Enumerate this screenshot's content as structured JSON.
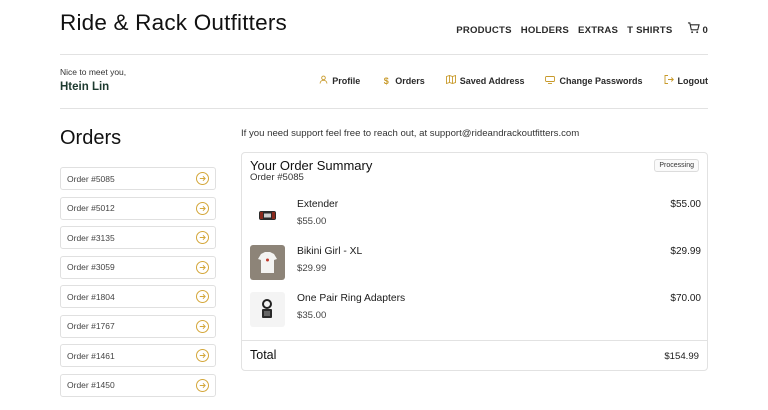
{
  "header": {
    "brand": "Ride & Rack Outfitters",
    "nav": [
      "PRODUCTS",
      "HOLDERS",
      "EXTRAS",
      "T SHIRTS"
    ],
    "cart_count": "0"
  },
  "account": {
    "greeting": "Nice to meet you,",
    "user_name": "Htein Lin",
    "menu": [
      {
        "label": "Profile",
        "icon": "user-icon"
      },
      {
        "label": "Orders",
        "icon": "dollar-icon"
      },
      {
        "label": "Saved Address",
        "icon": "map-icon"
      },
      {
        "label": "Change Passwords",
        "icon": "key-icon"
      },
      {
        "label": "Logout",
        "icon": "logout-icon"
      }
    ]
  },
  "orders": {
    "title": "Orders",
    "list": [
      "Order #5085",
      "Order #5012",
      "Order #3135",
      "Order #3059",
      "Order #1804",
      "Order #1767",
      "Order #1461",
      "Order #1450"
    ]
  },
  "support_text": "If you need support feel free to reach out, at support@rideandrackoutfitters.com",
  "summary": {
    "title": "Your Order Summary",
    "order_number": "Order #5085",
    "status": "Processing",
    "items": [
      {
        "name": "Extender",
        "unit_price": "$55.00",
        "total": "$55.00"
      },
      {
        "name": "Bikini Girl - XL",
        "unit_price": "$29.99",
        "total": "$29.99"
      },
      {
        "name": "One Pair Ring Adapters",
        "unit_price": "$35.00",
        "total": "$70.00"
      }
    ],
    "total_label": "Total",
    "total_value": "$154.99"
  },
  "colors": {
    "accent": "#c89a2a",
    "username": "#1d3a2f",
    "border": "#e2e2e2"
  }
}
